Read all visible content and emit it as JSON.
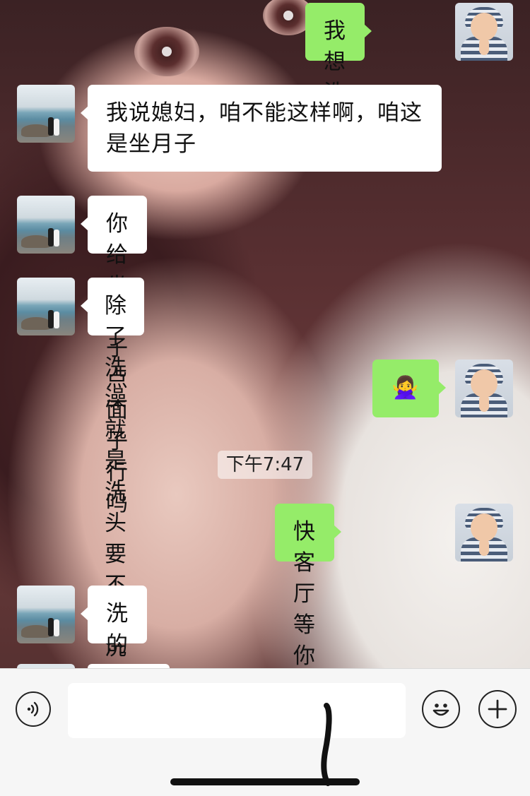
{
  "chat": {
    "messages": [
      {
        "sender": "me",
        "text": "我想洗脚"
      },
      {
        "sender": "other",
        "text": "我说媳妇，咱不能这样啊，咱这是坐月子"
      },
      {
        "sender": "other",
        "text": "你给坐月子点面子行吗"
      },
      {
        "sender": "other",
        "text": "除了洗澡就是洗头要不就洗脚"
      },
      {
        "sender": "me",
        "text": "🙅‍♀️"
      },
      {
        "sender": "me",
        "text": "快 客厅等你"
      },
      {
        "sender": "other",
        "text": "洗的太勤了"
      }
    ],
    "timestamp": "下午7:47"
  },
  "colors": {
    "outgoing_bubble": "#95ec69",
    "incoming_bubble": "#ffffff",
    "input_bar": "#f6f6f6"
  },
  "input_bar": {
    "voice_icon": "voice-wave-icon",
    "emoji_icon": "smiley-icon",
    "plus_icon": "plus-icon",
    "text_value": ""
  }
}
